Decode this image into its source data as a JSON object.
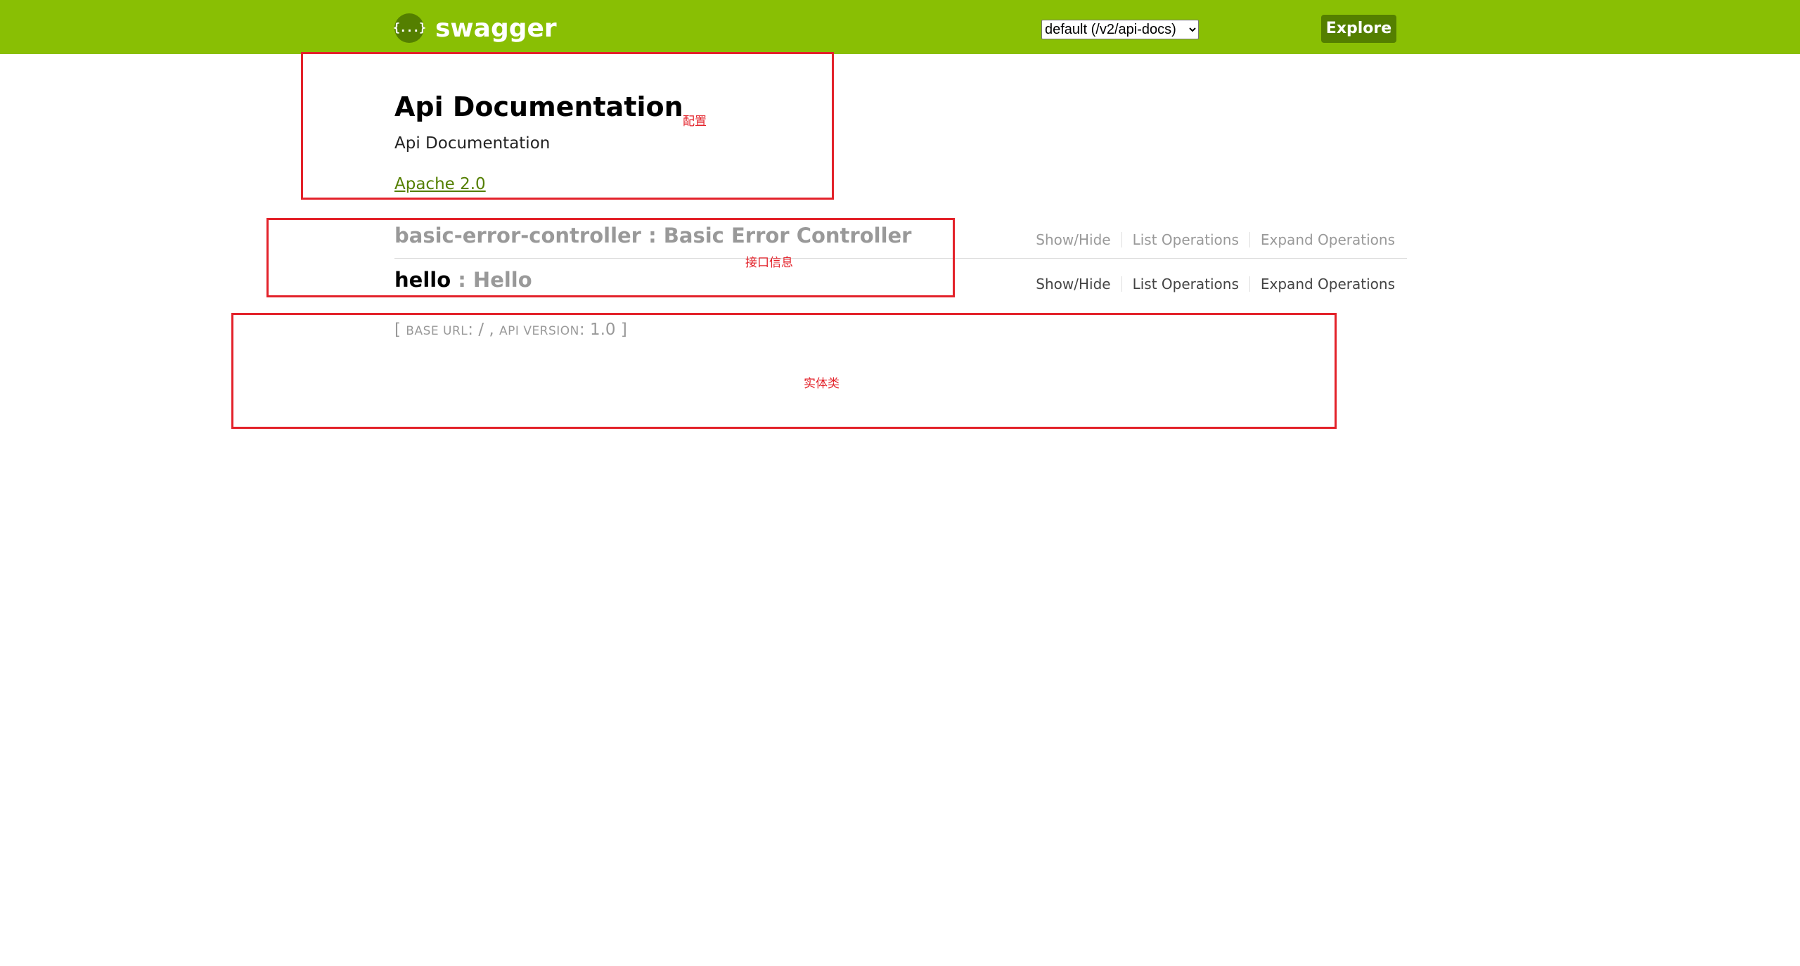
{
  "header": {
    "logo_icon": "{...}",
    "logo_text": "swagger",
    "spec_select": {
      "selected": "default (/v2/api-docs)",
      "options": [
        "default (/v2/api-docs)"
      ]
    },
    "explore_label": "Explore",
    "background_color": "#89bf04",
    "button_color": "#547f00"
  },
  "info": {
    "title": "Api Documentation",
    "description": "Api Documentation",
    "license": "Apache 2.0"
  },
  "resources": [
    {
      "path": "basic-error-controller",
      "separator": " : ",
      "description": "Basic Error Controller",
      "ops": {
        "show_hide": "Show/Hide",
        "list": "List Operations",
        "expand": "Expand Operations"
      }
    },
    {
      "path": "hello",
      "separator": " : ",
      "description": "Hello",
      "ops": {
        "show_hide": "Show/Hide",
        "list": "List Operations",
        "expand": "Expand Operations"
      }
    }
  ],
  "footer": {
    "open": "[ ",
    "base_url_label": "base url",
    "base_url_value": ": / , ",
    "api_version_label": "api version",
    "api_version_value": ": 1.0 ]"
  },
  "annotations": {
    "config_label": "配置",
    "interface_label": "接口信息",
    "entity_label": "实体类",
    "color": "#e3222a"
  }
}
